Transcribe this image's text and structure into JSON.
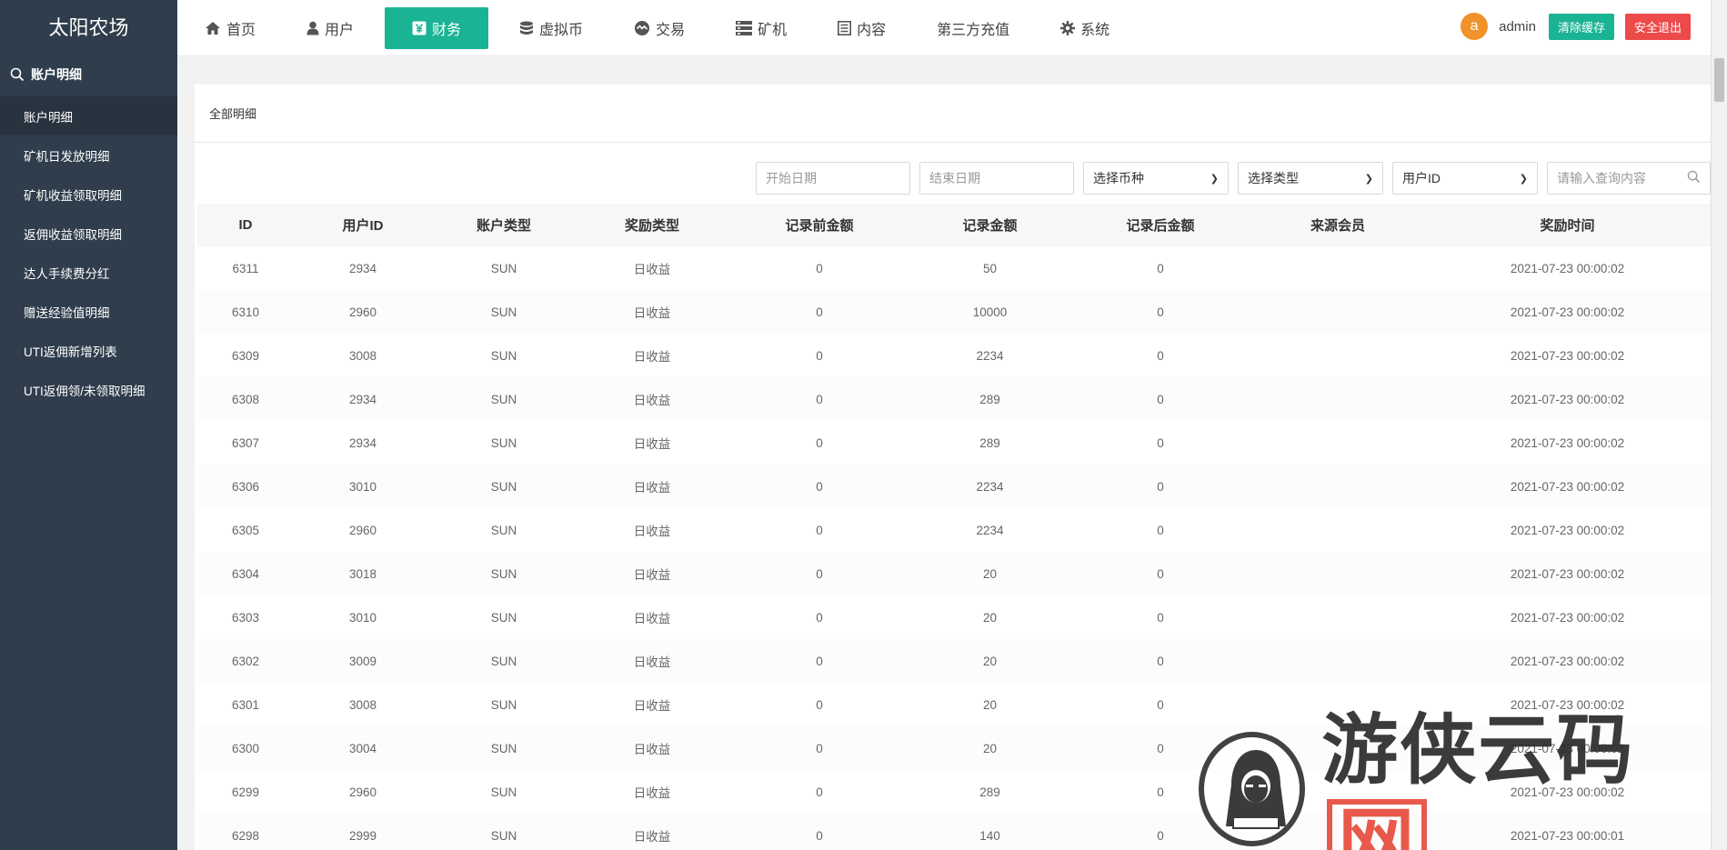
{
  "brand": "太阳农场",
  "sidebar": {
    "section": "账户明细",
    "items": [
      {
        "label": "账户明细"
      },
      {
        "label": "矿机日发放明细"
      },
      {
        "label": "矿机收益领取明细"
      },
      {
        "label": "返佣收益领取明细"
      },
      {
        "label": "达人手续费分红"
      },
      {
        "label": "赠送经验值明细"
      },
      {
        "label": "UTI返佣新增列表"
      },
      {
        "label": "UTI返佣领/未领取明细"
      }
    ]
  },
  "nav": {
    "items": [
      {
        "label": "首页",
        "icon": "home-icon"
      },
      {
        "label": "用户",
        "icon": "user-icon"
      },
      {
        "label": "财务",
        "icon": "yen-icon"
      },
      {
        "label": "虚拟币",
        "icon": "database-icon"
      },
      {
        "label": "交易",
        "icon": "exchange-icon"
      },
      {
        "label": "矿机",
        "icon": "server-icon"
      },
      {
        "label": "内容",
        "icon": "document-icon"
      },
      {
        "label": "第三方充值",
        "icon": ""
      },
      {
        "label": "系统",
        "icon": "gear-icon"
      }
    ],
    "avatar_letter": "a",
    "username": "admin",
    "clear_cache": "清除缓存",
    "logout": "安全退出"
  },
  "tab": "全部明细",
  "filters": {
    "start_date": "开始日期",
    "end_date": "结束日期",
    "currency": "选择币种",
    "type": "选择类型",
    "user_field": "用户ID",
    "search_placeholder": "请输入查询内容"
  },
  "table": {
    "headers": [
      "ID",
      "用户ID",
      "账户类型",
      "奖励类型",
      "记录前金额",
      "记录金额",
      "记录后金额",
      "来源会员",
      "奖励时间"
    ],
    "rows": [
      [
        "6311",
        "2934",
        "SUN",
        "日收益",
        "0",
        "50",
        "0",
        "",
        "2021-07-23 00:00:02"
      ],
      [
        "6310",
        "2960",
        "SUN",
        "日收益",
        "0",
        "10000",
        "0",
        "",
        "2021-07-23 00:00:02"
      ],
      [
        "6309",
        "3008",
        "SUN",
        "日收益",
        "0",
        "2234",
        "0",
        "",
        "2021-07-23 00:00:02"
      ],
      [
        "6308",
        "2934",
        "SUN",
        "日收益",
        "0",
        "289",
        "0",
        "",
        "2021-07-23 00:00:02"
      ],
      [
        "6307",
        "2934",
        "SUN",
        "日收益",
        "0",
        "289",
        "0",
        "",
        "2021-07-23 00:00:02"
      ],
      [
        "6306",
        "3010",
        "SUN",
        "日收益",
        "0",
        "2234",
        "0",
        "",
        "2021-07-23 00:00:02"
      ],
      [
        "6305",
        "2960",
        "SUN",
        "日收益",
        "0",
        "2234",
        "0",
        "",
        "2021-07-23 00:00:02"
      ],
      [
        "6304",
        "3018",
        "SUN",
        "日收益",
        "0",
        "20",
        "0",
        "",
        "2021-07-23 00:00:02"
      ],
      [
        "6303",
        "3010",
        "SUN",
        "日收益",
        "0",
        "20",
        "0",
        "",
        "2021-07-23 00:00:02"
      ],
      [
        "6302",
        "3009",
        "SUN",
        "日收益",
        "0",
        "20",
        "0",
        "",
        "2021-07-23 00:00:02"
      ],
      [
        "6301",
        "3008",
        "SUN",
        "日收益",
        "0",
        "20",
        "0",
        "",
        "2021-07-23 00:00:02"
      ],
      [
        "6300",
        "3004",
        "SUN",
        "日收益",
        "0",
        "20",
        "0",
        "",
        "2021-07-23 00:00:02"
      ],
      [
        "6299",
        "2960",
        "SUN",
        "日收益",
        "0",
        "289",
        "0",
        "",
        "2021-07-23 00:00:02"
      ],
      [
        "6298",
        "2999",
        "SUN",
        "日收益",
        "0",
        "140",
        "0",
        "",
        "2021-07-23 00:00:01"
      ]
    ]
  },
  "watermark": {
    "text": "游侠云码",
    "box": "网"
  }
}
